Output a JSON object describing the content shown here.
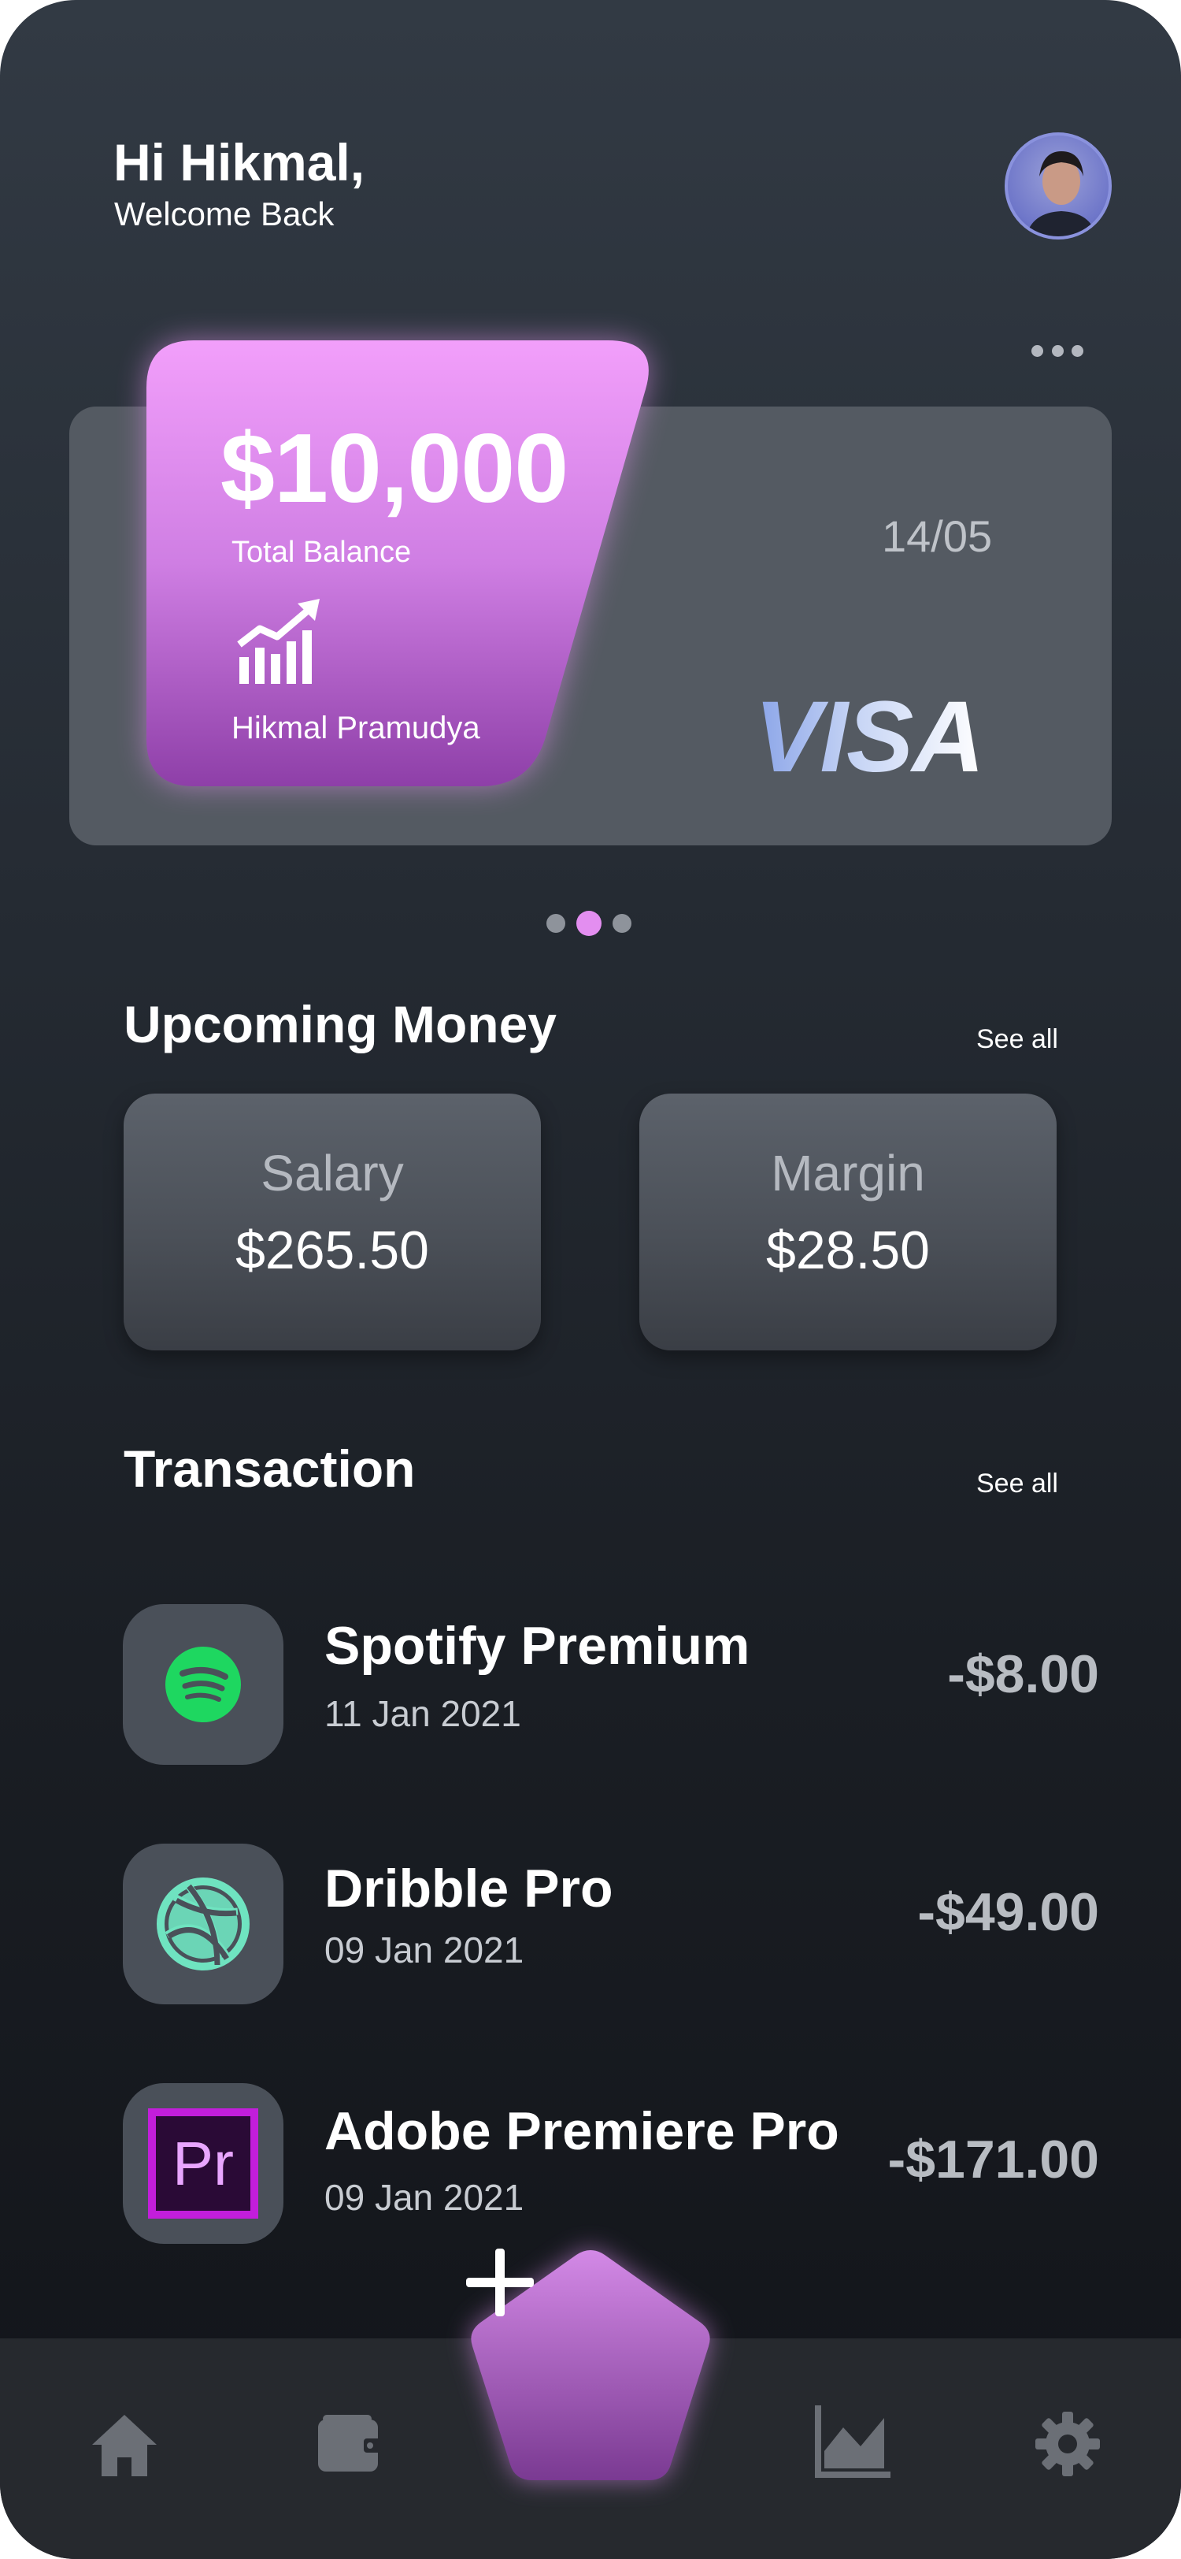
{
  "header": {
    "greeting": "Hi Hikmal,",
    "subtitle": "Welcome Back"
  },
  "card": {
    "amount": "$10,000",
    "balance_label": "Total Balance",
    "holder_name": "Hikmal Pramudya",
    "expiry": "14/05",
    "brand": "VISA",
    "accent_color": "#e38ef0"
  },
  "pager": {
    "count": 3,
    "active_index": 1
  },
  "upcoming": {
    "title": "Upcoming Money",
    "see_all": "See all",
    "items": [
      {
        "label": "Salary",
        "value": "$265.50"
      },
      {
        "label": "Margin",
        "value": "$28.50"
      }
    ]
  },
  "transactions": {
    "title": "Transaction",
    "see_all": "See all",
    "items": [
      {
        "name": "Spotify Premium",
        "date": "11 Jan 2021",
        "amount": "-$8.00",
        "icon": "spotify-icon"
      },
      {
        "name": "Dribble Pro",
        "date": "09 Jan 2021",
        "amount": "-$49.00",
        "icon": "dribbble-icon"
      },
      {
        "name": "Adobe Premiere Pro",
        "date": "09 Jan 2021",
        "amount": "-$171.00",
        "icon": "premiere-pro-icon",
        "icon_text": "Pr"
      }
    ]
  },
  "bottom_nav": {
    "items": [
      "home-icon",
      "wallet-icon",
      "add-icon",
      "chart-icon",
      "settings-icon"
    ]
  }
}
